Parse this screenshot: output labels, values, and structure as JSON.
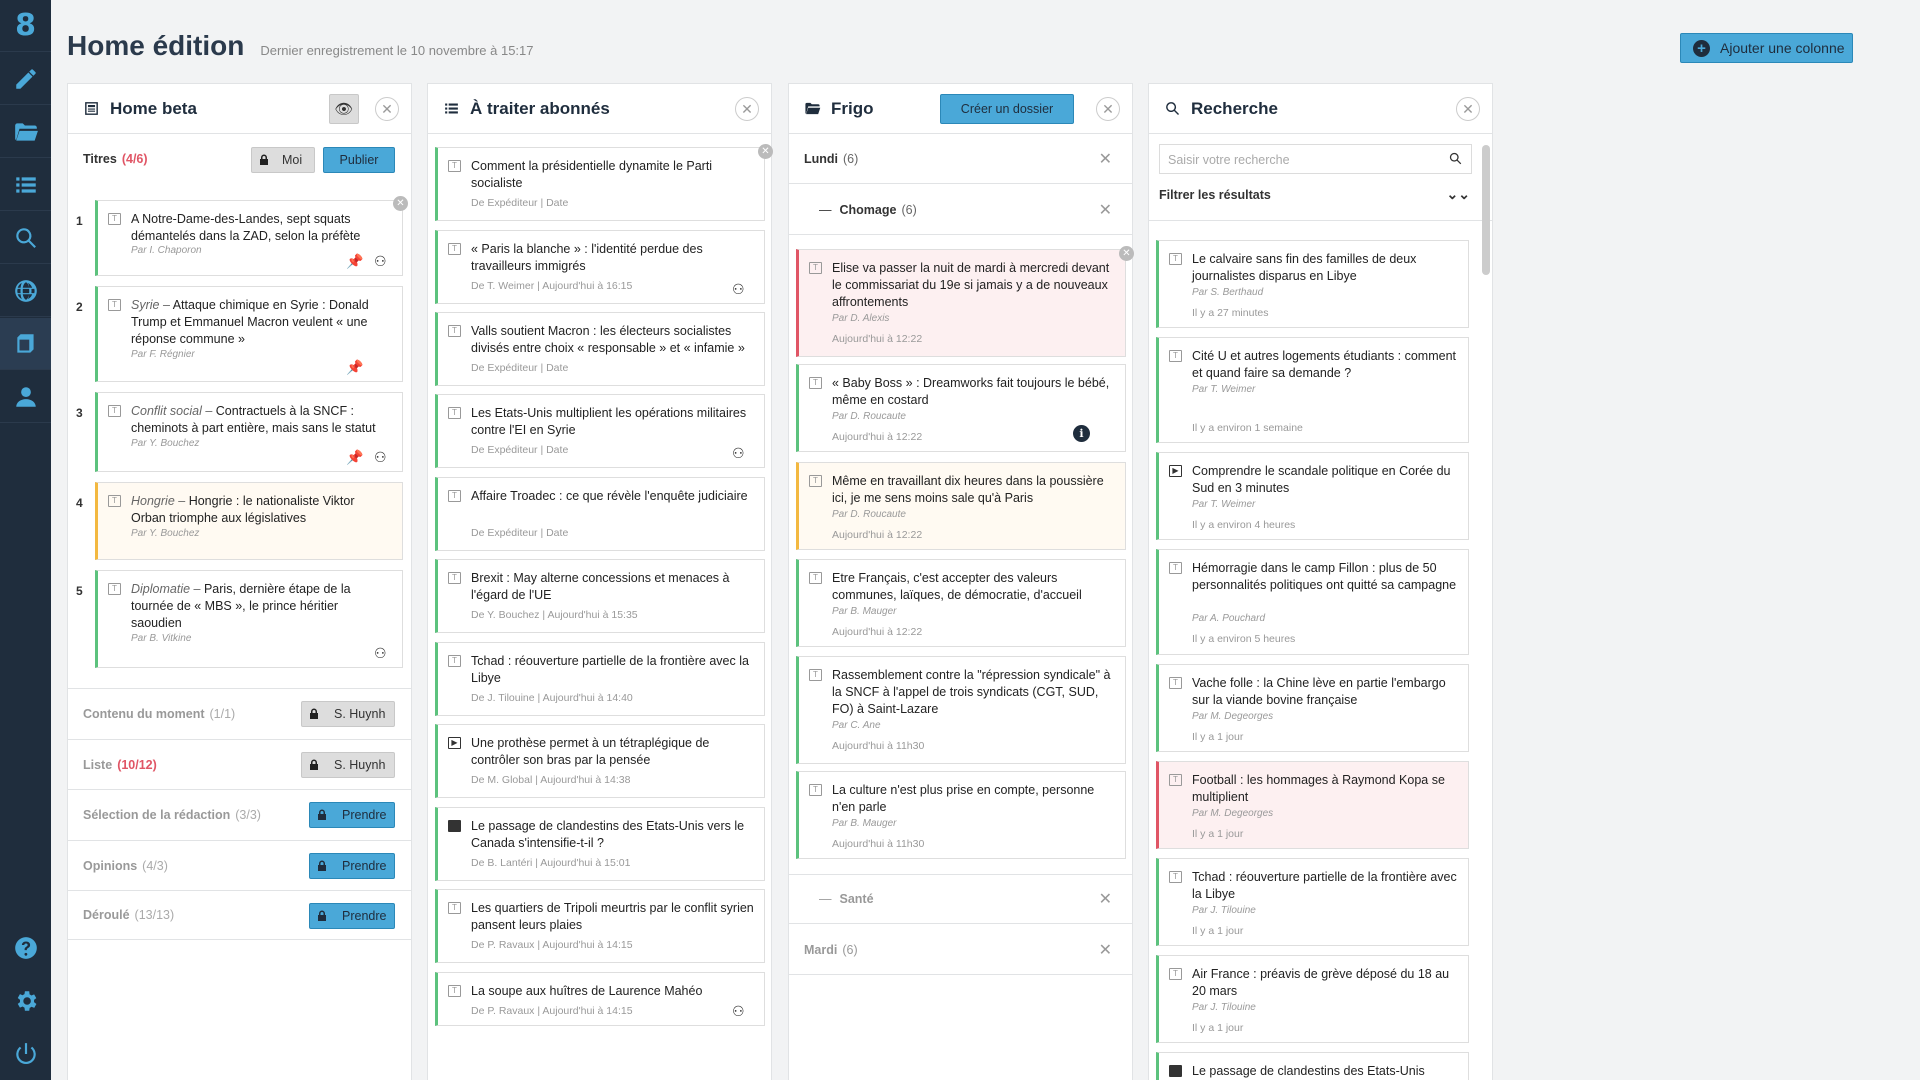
{
  "sidebar": {
    "logo": "8",
    "items": [
      "edit-icon",
      "folder-icon",
      "list-icon",
      "search-icon",
      "globe-icon",
      "inbox-icon",
      "user-icon"
    ],
    "bottom": [
      "help-icon",
      "settings-icon",
      "power-icon"
    ]
  },
  "header": {
    "title": "Home édition",
    "subtitle": "Dernier enregistrement le 10 novembre à 15:17",
    "add_column": "Ajouter une colonne"
  },
  "columns": {
    "home": {
      "title": "Home beta",
      "sections": {
        "titres": {
          "label": "Titres",
          "count": "(4/6)",
          "moi": "Moi",
          "publier": "Publier"
        },
        "contenu": {
          "label": "Contenu du moment",
          "count": "(1/1)",
          "btn": "S. Huynh"
        },
        "liste": {
          "label": "Liste",
          "count": "(10/12)",
          "btn": "S. Huynh"
        },
        "selection": {
          "label": "Sélection de la rédaction",
          "count": "(3/3)",
          "btn": "Prendre"
        },
        "opinions": {
          "label": "Opinions",
          "count": "(4/3)",
          "btn": "Prendre"
        },
        "deroule": {
          "label": "Déroulé",
          "count": "(13/13)",
          "btn": "Prendre"
        }
      },
      "items": [
        {
          "num": "1",
          "rubric": "",
          "title": "A Notre-Dame-des-Landes, sept squats démantelés dans la ZAD, selon la préfète",
          "author": "Par I. Chaporon"
        },
        {
          "num": "2",
          "rubric": "Syrie –",
          "title": "Attaque chimique en Syrie : Donald Trump et Emmanuel Macron veulent « une réponse commune »",
          "author": "Par F. Régnier"
        },
        {
          "num": "3",
          "rubric": "Conflit social –",
          "title": "Contractuels à la SNCF : cheminots à part entière, mais sans le statut",
          "author": "Par Y. Bouchez"
        },
        {
          "num": "4",
          "rubric": "Hongrie –",
          "title": "Hongrie : le nationaliste Viktor Orban triomphe aux législatives",
          "author": "Par Y. Bouchez"
        },
        {
          "num": "5",
          "rubric": "Diplomatie –",
          "title": "Paris, dernière étape de la tournée de « MBS », le prince héritier saoudien",
          "author": "Par B. Vitkine"
        }
      ]
    },
    "traiter": {
      "title": "À traiter abonnés",
      "items": [
        {
          "title": "Comment la présidentielle dynamite le Parti socialiste",
          "meta": "De Expéditeur | Date"
        },
        {
          "title": "« Paris la blanche » : l'identité perdue des travailleurs immigrés",
          "meta": "De T. Weimer  |  Aujourd'hui à 16:15"
        },
        {
          "title": "Valls soutient Macron : les électeurs socialistes divisés entre choix « responsable » et « infamie »",
          "meta": "De Expéditeur | Date"
        },
        {
          "title": "Les Etats-Unis multiplient les opérations militaires contre l'EI en Syrie",
          "meta": "De Expéditeur | Date"
        },
        {
          "title": "Affaire Troadec : ce que révèle l'enquête judiciaire",
          "meta": "De Expéditeur | Date"
        },
        {
          "title": "Brexit : May alterne concessions et menaces à l'égard de l'UE",
          "meta": "De Y. Bouchez  |  Aujourd'hui à 15:35"
        },
        {
          "title": "Tchad : réouverture partielle de la frontière avec la Libye",
          "meta": "De J. Tilouine  |  Aujourd'hui à 14:40"
        },
        {
          "title": "Une prothèse permet à un tétraplégique de contrôler son bras par la pensée",
          "meta": "De M. Global  |  Aujourd'hui à 14:38"
        },
        {
          "title": "Le passage de clandestins des Etats-Unis vers le Canada s'intensifie-t-il ?",
          "meta": "De B. Lantéri  |  Aujourd'hui à 15:01"
        },
        {
          "title": "Les quartiers de Tripoli meurtris par le conflit syrien pansent leurs plaies",
          "meta": "De P. Ravaux  |  Aujourd'hui à 14:15"
        },
        {
          "title": "La soupe aux huîtres de Laurence Mahéo",
          "meta": "De P. Ravaux  |  Aujourd'hui à 14:15"
        }
      ]
    },
    "frigo": {
      "title": "Frigo",
      "create_btn": "Créer un dossier",
      "groups": {
        "lundi": {
          "label": "Lundi",
          "count": "(6)"
        },
        "chomage": {
          "label": "Chomage",
          "count": "(6)"
        },
        "sante": {
          "label": "Santé"
        },
        "mardi": {
          "label": "Mardi",
          "count": "(6)"
        }
      },
      "items": [
        {
          "title": "Elise va passer la nuit de mardi à mercredi devant le commissariat du 19e si jamais y a de nouveaux affrontements",
          "author": "Par D. Alexis",
          "date": "Aujourd'hui à 12:22"
        },
        {
          "title": "« Baby Boss » : Dreamworks fait toujours le bébé, même en costard",
          "author": "Par D. Roucaute",
          "date": "Aujourd'hui à 12:22"
        },
        {
          "title": "Même en travaillant dix heures dans la poussière ici, je me sens moins sale qu'à Paris",
          "author": "Par D. Roucaute",
          "date": "Aujourd'hui à 12:22"
        },
        {
          "title": "Etre Français, c'est accepter des valeurs communes, laïques, de démocratie, d'accueil",
          "author": "Par B. Mauger",
          "date": "Aujourd'hui à 12:22"
        },
        {
          "title": "Rassemblement contre la \"répression syndicale\" à la SNCF à l'appel de trois syndicats (CGT, SUD, FO) à Saint-Lazare",
          "author": "Par C. Ane",
          "date": "Aujourd'hui à 11h30"
        },
        {
          "title": "La culture n'est plus prise en compte, personne n'en parle",
          "author": "Par B. Mauger",
          "date": "Aujourd'hui à 11h30"
        }
      ]
    },
    "recherche": {
      "title": "Recherche",
      "placeholder": "Saisir votre recherche",
      "filter": "Filtrer les résultats",
      "items": [
        {
          "title": "Le calvaire sans fin des familles de deux journalistes disparus en Libye",
          "author": "Par S. Berthaud",
          "date": "Il y a 27 minutes"
        },
        {
          "title": "Cité U et autres logements étudiants : comment et quand faire sa demande ?",
          "author": "Par T. Weimer",
          "date": "Il y a environ 1 semaine"
        },
        {
          "title": "Comprendre le scandale politique en Corée du Sud en 3 minutes",
          "author": "Par T. Weimer",
          "date": "Il y a environ 4 heures"
        },
        {
          "title": "Hémorragie dans le camp Fillon : plus de 50 personnalités politiques ont quitté sa campagne",
          "author": "Par A. Pouchard",
          "date": "Il y a environ 5 heures"
        },
        {
          "title": "Vache folle : la Chine lève en partie l'embargo sur la viande bovine française",
          "author": "Par M. Degeorges",
          "date": "Il y a 1 jour"
        },
        {
          "title": "Football : les hommages à Raymond Kopa se multiplient",
          "author": "Par M. Degeorges",
          "date": "Il y a 1 jour"
        },
        {
          "title": "Tchad : réouverture partielle de la frontière avec la Libye",
          "author": "Par J. Tilouine",
          "date": "Il y a 1 jour"
        },
        {
          "title": "Air France : préavis de grève déposé du 18 au 20 mars",
          "author": "Par J. Tilouine",
          "date": "Il y a 1 jour"
        },
        {
          "title": "Le passage de clandestins des Etats-Unis",
          "author": "",
          "date": ""
        }
      ]
    }
  },
  "colors": {
    "accent": "#4aa8d8",
    "green": "#5cc27d",
    "red": "#e05565",
    "orange": "#f3b840",
    "sidebar": "#1f2d3d"
  }
}
